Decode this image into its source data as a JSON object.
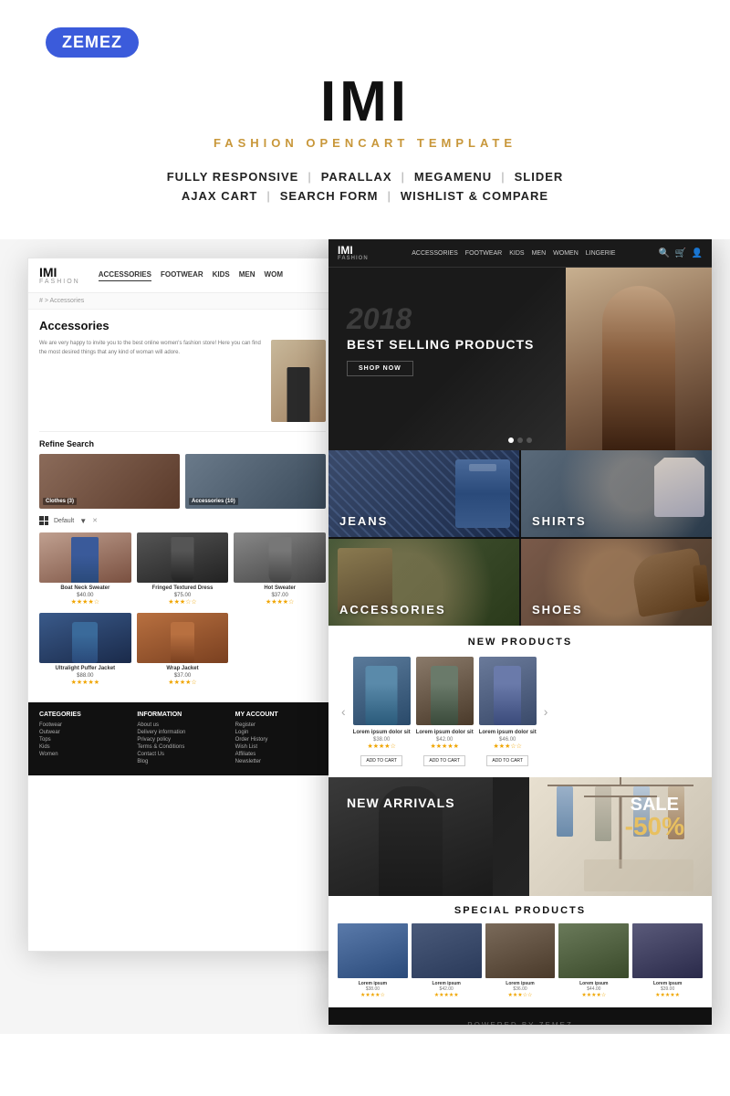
{
  "brand": {
    "zemez_label": "ZEMEZ",
    "site_title": "IMI",
    "site_subtitle": "FASHION OPENCART TEMPLATE"
  },
  "features": {
    "row1": [
      {
        "label": "FULLY RESPONSIVE"
      },
      {
        "label": "PARALLAX"
      },
      {
        "label": "MEGAMENU"
      },
      {
        "label": "SLIDER"
      }
    ],
    "row2": [
      {
        "label": "AJAX CART"
      },
      {
        "label": "SEARCH FORM"
      },
      {
        "label": "WISHLIST & COMPARE"
      }
    ]
  },
  "left_screenshot": {
    "logo": "IMI",
    "logo_sub": "FASHION",
    "nav_links": [
      "ACCESSORIES",
      "FOOTWEAR",
      "KIDS",
      "MEN",
      "WOM"
    ],
    "breadcrumb": "# > Accessories",
    "page_title": "Accessories",
    "body_text_1": "We are very happy to invite you to the best online women's fashion store! Here you can find the most desired things that any kind of woman will adore.",
    "refine_title": "Refine Search",
    "categories": [
      {
        "label": "Clothes (3)"
      },
      {
        "label": "Accessories (10)"
      }
    ],
    "sort_label": "Default",
    "products": [
      {
        "name": "Boat Neck Sweater",
        "price": "$40.00"
      },
      {
        "name": "Fringed Textured Dress",
        "price": "$75.00"
      },
      {
        "name": "Hot Sweater",
        "price": "$37.00"
      },
      {
        "name": "Ultralight Puffer Jacket",
        "price": "$88.00"
      },
      {
        "name": "Wrap Jacket",
        "price": "$37.00"
      }
    ],
    "footer_cols": [
      {
        "title": "CATEGORIES",
        "links": [
          "Footwear",
          "Outwear",
          "Tops",
          "Kids",
          "Women"
        ]
      },
      {
        "title": "INFORMATION",
        "links": [
          "About us",
          "Delivery information",
          "Privacy policy",
          "Terms & Conditions",
          "Contact Us",
          "Blog"
        ]
      },
      {
        "title": "MY ACCOUNT",
        "links": [
          "Register",
          "Login",
          "Order History",
          "Wish List",
          "Affiliates",
          "Newsletter"
        ]
      }
    ]
  },
  "right_screenshot": {
    "logo": "IMI",
    "logo_sub": "FASHION",
    "nav_links": [
      "ACCESSORIES",
      "FOOTWEAR",
      "KIDS",
      "MEN",
      "WOMEN",
      "LINGERIE"
    ],
    "hero": {
      "year": "2018",
      "title": "BEST SELLING PRODUCTS",
      "btn_label": "SHOP NOW"
    },
    "categories": [
      {
        "name": "JEANS",
        "class": "jeans"
      },
      {
        "name": "SHIRTS",
        "class": "shirts"
      },
      {
        "name": "ACCESSORIES",
        "class": "accessories"
      },
      {
        "name": "SHOES",
        "class": "shoes"
      }
    ],
    "new_products_title": "NEW PRODUCTS",
    "products": [
      {
        "name": "Lorem ipsum dolor sit",
        "price": "$38.00"
      },
      {
        "name": "Lorem ipsum dolor sit",
        "price": "$42.00"
      },
      {
        "name": "Lorem ipsum dolor sit",
        "price": "$46.00"
      }
    ],
    "arrivals": {
      "title": "NEW ARRIVALS",
      "sale_text": "SALE",
      "sale_percent": "-50%"
    },
    "special_products_title": "SPECIAL PRODUCTS",
    "special_products": [
      {
        "name": "Lorem ipsum",
        "price": "$38.00"
      },
      {
        "name": "Lorem ipsum",
        "price": "$42.00"
      },
      {
        "name": "Lorem ipsum",
        "price": "$36.00"
      },
      {
        "name": "Lorem ipsum",
        "price": "$44.00"
      },
      {
        "name": "Lorem ipsum",
        "price": "$39.00"
      }
    ]
  }
}
